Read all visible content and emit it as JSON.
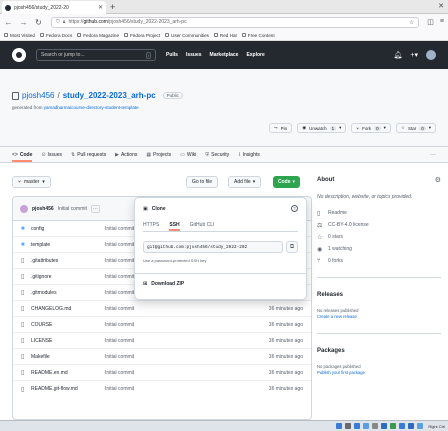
{
  "browser": {
    "tab_title": "pjosh456/study_2022-20",
    "url_domain": "github.com",
    "url_prefix": "https://",
    "url_path": "/pjosh456/study_2022-2023_arh-pc"
  },
  "bookmarks": [
    {
      "label": "Most Visited"
    },
    {
      "label": "Fedora Docs"
    },
    {
      "label": "Fedora Magazine"
    },
    {
      "label": "Fedora Project"
    },
    {
      "label": "User Communities"
    },
    {
      "label": "Red Hat"
    },
    {
      "label": "Free Content"
    }
  ],
  "gh_header": {
    "search_placeholder": "Search or jump to...",
    "search_shortcut": "/",
    "nav": [
      "Pulls",
      "Issues",
      "Marketplace",
      "Explore"
    ],
    "icons": [
      "bell-icon",
      "plus-icon",
      "avatar"
    ]
  },
  "repo": {
    "owner": "pjosh456",
    "name": "study_2022-2023_arh-pc",
    "visibility": "Public",
    "generated_prefix": "generated from",
    "template": "yamadharma/course-directory-student-template",
    "actions": [
      {
        "label": "Pin",
        "count": ""
      },
      {
        "label": "Unwatch",
        "count": "1"
      },
      {
        "label": "Fork",
        "count": "0"
      },
      {
        "label": "Star",
        "count": "0"
      }
    ]
  },
  "repo_tabs": [
    {
      "icon": "<>",
      "label": "Code"
    },
    {
      "icon": "⊙",
      "label": "Issues"
    },
    {
      "icon": "⇅",
      "label": "Pull requests"
    },
    {
      "icon": "▶",
      "label": "Actions"
    },
    {
      "icon": "▦",
      "label": "Projects"
    },
    {
      "icon": "▭",
      "label": "Wiki"
    },
    {
      "icon": "⛨",
      "label": "Security"
    },
    {
      "icon": "⌇",
      "label": "Insights"
    }
  ],
  "filebar": {
    "branch": "master",
    "go_to_file": "Go to file",
    "add_file": "Add file",
    "code": "Code"
  },
  "commit": {
    "author": "pjosh456",
    "message": "Initial commit"
  },
  "files": [
    {
      "type": "dir",
      "name": "config",
      "commit": "Initial commit",
      "time": ""
    },
    {
      "type": "dir",
      "name": "template",
      "commit": "Initial commit",
      "time": ""
    },
    {
      "type": "file",
      "name": ".gitattributes",
      "commit": "Initial commit",
      "time": ""
    },
    {
      "type": "file",
      "name": ".gitignore",
      "commit": "Initial commit",
      "time": ""
    },
    {
      "type": "file",
      "name": ".gitmodules",
      "commit": "Initial commit",
      "time": "36 minutes ago"
    },
    {
      "type": "file",
      "name": "CHANGELOG.md",
      "commit": "Initial commit",
      "time": "36 minutes ago"
    },
    {
      "type": "file",
      "name": "COURSE",
      "commit": "Initial commit",
      "time": "36 minutes ago"
    },
    {
      "type": "file",
      "name": "LICENSE",
      "commit": "Initial commit",
      "time": "36 minutes ago"
    },
    {
      "type": "file",
      "name": "Makefile",
      "commit": "Initial commit",
      "time": "36 minutes ago"
    },
    {
      "type": "file",
      "name": "README.en.md",
      "commit": "Initial commit",
      "time": "36 minutes ago"
    },
    {
      "type": "file",
      "name": "README.git-flow.md",
      "commit": "Initial commit",
      "time": "36 minutes ago"
    }
  ],
  "clone_popover": {
    "title": "Clone",
    "tabs": [
      "HTTPS",
      "SSH",
      "GitHub CLI"
    ],
    "active_tab": "SSH",
    "url": "git@github.com:pjosh456/study_2022-202",
    "note": "Use a password-protected SSH key.",
    "download": "Download ZIP"
  },
  "about": {
    "title": "About",
    "description": "No description, website, or topics provided.",
    "items": [
      {
        "icon": "book-icon",
        "glyph": "▯",
        "label": "Readme"
      },
      {
        "icon": "scale-icon",
        "glyph": "⚖",
        "label": "CC-BY-4.0 license"
      },
      {
        "icon": "star-icon",
        "glyph": "☆",
        "label": "0 stars"
      },
      {
        "icon": "eye-icon",
        "glyph": "◉",
        "label": "1 watching"
      },
      {
        "icon": "fork-icon",
        "glyph": "⑂",
        "label": "0 forks"
      }
    ]
  },
  "releases": {
    "title": "Releases",
    "empty": "No releases published",
    "link": "Create a new release"
  },
  "packages": {
    "title": "Packages",
    "empty": "No packages published",
    "link": "Publish your first package"
  },
  "taskbar": {
    "right_label": "Right Ctrl"
  },
  "colors": {
    "header": "#24292f",
    "link": "#0969da",
    "code_button": "#2da44e",
    "active_tab_underline": "#fd8c73"
  }
}
